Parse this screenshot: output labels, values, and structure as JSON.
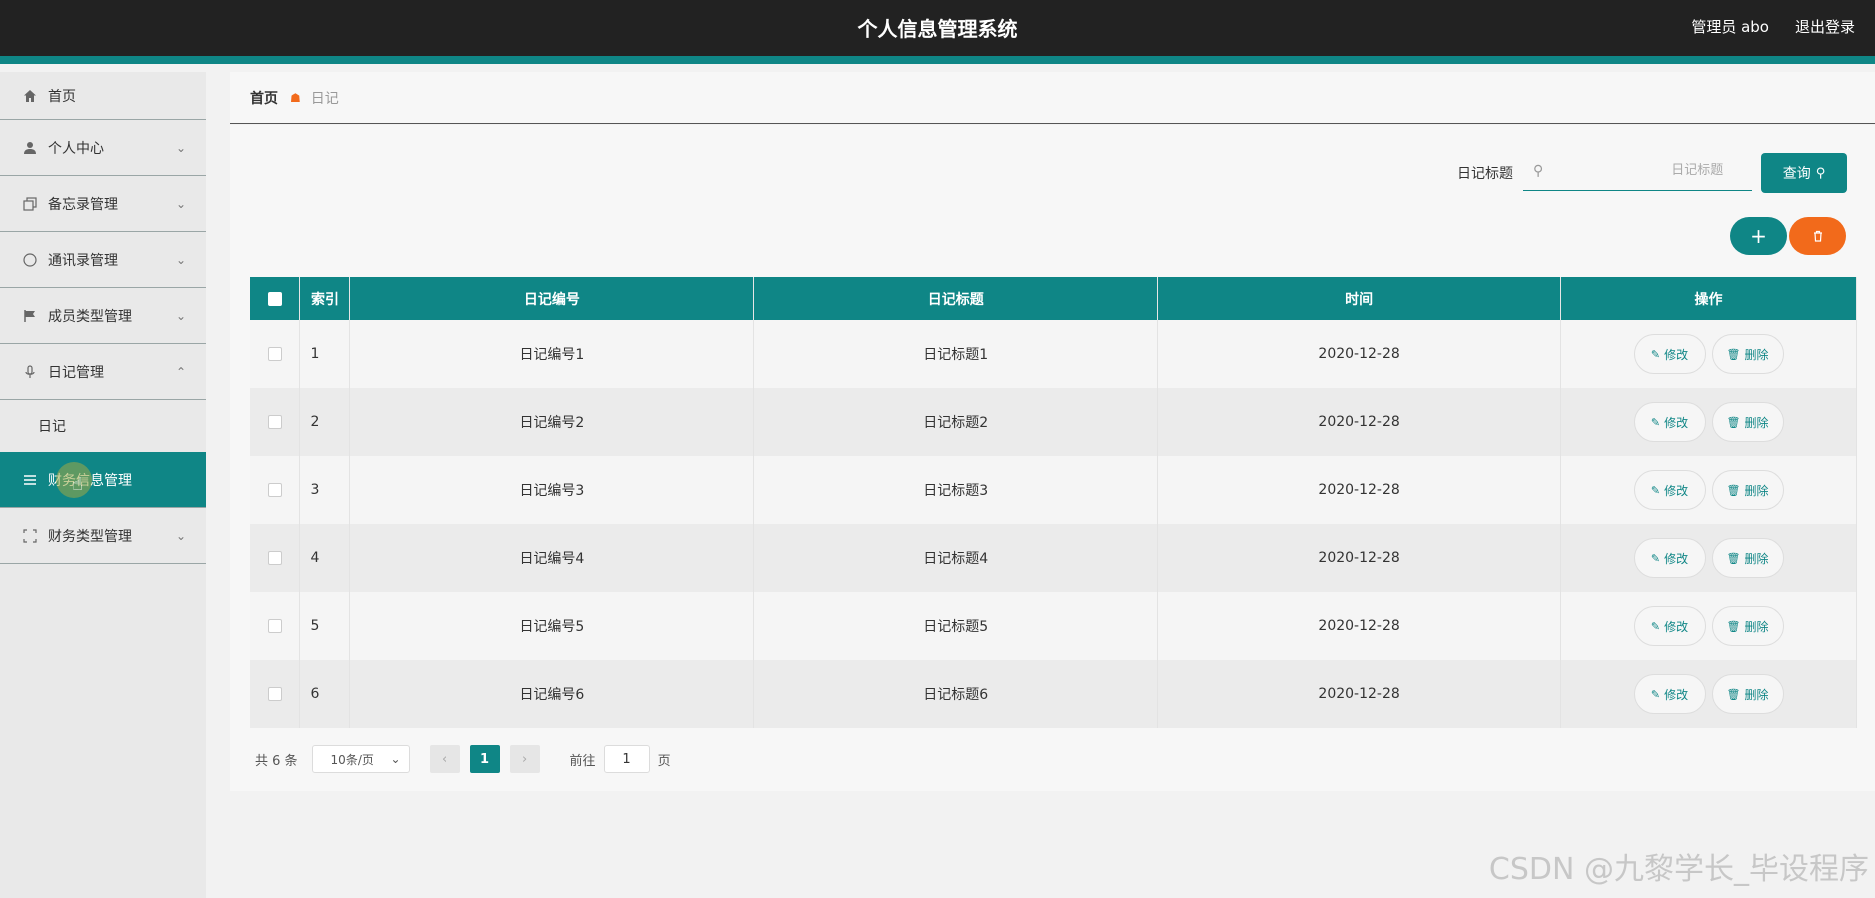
{
  "header": {
    "title": "个人信息管理系统",
    "user": "管理员 abo",
    "logout": "退出登录"
  },
  "sidebar": {
    "items": [
      {
        "label": "首页",
        "icon": "home-icon"
      },
      {
        "label": "个人中心",
        "icon": "user-icon"
      },
      {
        "label": "备忘录管理",
        "icon": "copy-icon"
      },
      {
        "label": "通讯录管理",
        "icon": "compass-icon"
      },
      {
        "label": "成员类型管理",
        "icon": "flag-icon"
      },
      {
        "label": "日记管理",
        "icon": "microphone-icon"
      },
      {
        "label": "财务信息管理",
        "icon": "menu-icon"
      },
      {
        "label": "财务类型管理",
        "icon": "fullscreen-icon"
      }
    ],
    "submenu": {
      "label": "日记"
    }
  },
  "breadcrumb": {
    "home": "首页",
    "current": "日记"
  },
  "search": {
    "label": "日记标题",
    "placeholder": "日记标题",
    "button": "查询"
  },
  "table": {
    "columns": [
      "索引",
      "日记编号",
      "日记标题",
      "时间",
      "操作"
    ],
    "rows": [
      {
        "index": "1",
        "code": "日记编号1",
        "title": "日记标题1",
        "time": "2020-12-28"
      },
      {
        "index": "2",
        "code": "日记编号2",
        "title": "日记标题2",
        "time": "2020-12-28"
      },
      {
        "index": "3",
        "code": "日记编号3",
        "title": "日记标题3",
        "time": "2020-12-28"
      },
      {
        "index": "4",
        "code": "日记编号4",
        "title": "日记标题4",
        "time": "2020-12-28"
      },
      {
        "index": "5",
        "code": "日记编号5",
        "title": "日记标题5",
        "time": "2020-12-28"
      },
      {
        "index": "6",
        "code": "日记编号6",
        "title": "日记标题6",
        "time": "2020-12-28"
      }
    ],
    "edit_label": "修改",
    "delete_label": "删除"
  },
  "pagination": {
    "total": "共 6 条",
    "page_size": "10条/页",
    "current_page": "1",
    "goto_prefix": "前往",
    "goto_value": "1",
    "goto_suffix": "页"
  },
  "watermark": "CSDN @九黎学长_毕设程序",
  "colors": {
    "primary": "#0f8686",
    "accent": "#f26a1b",
    "header_bg": "#222222"
  }
}
